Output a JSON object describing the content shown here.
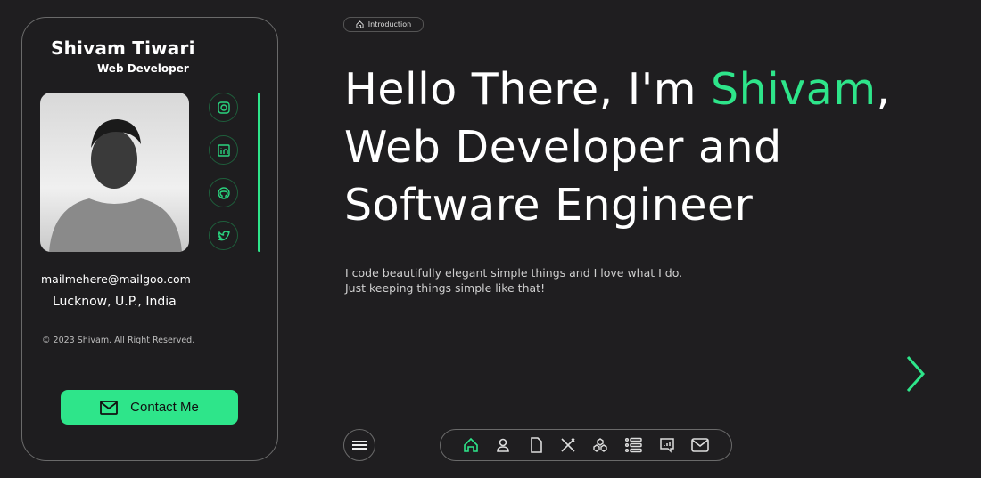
{
  "profile": {
    "name": "Shivam Tiwari",
    "role": "Web Developer",
    "email": "mailmehere@mailgoo.com",
    "location": "Lucknow, U.P., India",
    "copyright": "© 2023 Shivam. All Right Reserved.",
    "contact_label": "Contact Me"
  },
  "socials": [
    "instagram-icon",
    "linkedin-icon",
    "github-icon",
    "twitter-icon"
  ],
  "hero": {
    "section_label": "Introduction",
    "line1_pre": "Hello There, I'm ",
    "line1_name": "Shivam",
    "line1_post": ",",
    "line2": "Web Developer and",
    "line3": "Software Engineer",
    "desc1": "I code beautifully elegant simple things and I love what I do.",
    "desc2": "Just keeping things simple like that!"
  },
  "nav": [
    "home",
    "about",
    "resume",
    "services",
    "skills",
    "portfolio",
    "testimonials",
    "contact"
  ],
  "colors": {
    "accent": "#2ee58a",
    "background": "#1f1e20"
  }
}
